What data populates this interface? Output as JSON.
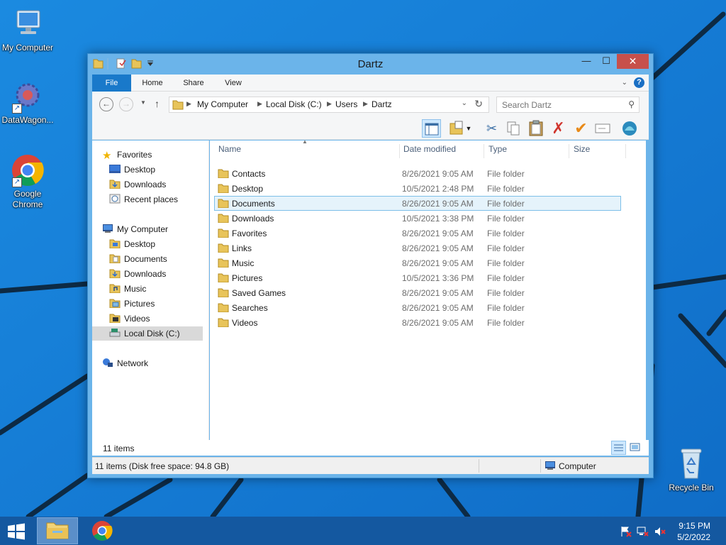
{
  "desktop": {
    "icons": [
      {
        "label": "My Computer"
      },
      {
        "label": "DataWagon..."
      },
      {
        "label": "Google Chrome"
      },
      {
        "label": "Recycle Bin"
      }
    ]
  },
  "window": {
    "title": "Dartz",
    "controls": {
      "minimize": "—",
      "maximize": "☐",
      "close": "✕"
    },
    "ribbon_tabs": {
      "file": "File",
      "home": "Home",
      "share": "Share",
      "view": "View"
    },
    "help": "?",
    "address": {
      "crumbs": [
        "My Computer",
        "Local Disk (C:)",
        "Users",
        "Dartz"
      ]
    },
    "search": {
      "placeholder": "Search Dartz"
    },
    "nav_pane": {
      "favorites": {
        "label": "Favorites",
        "items": [
          "Desktop",
          "Downloads",
          "Recent places"
        ]
      },
      "computer": {
        "label": "My Computer",
        "items": [
          "Desktop",
          "Documents",
          "Downloads",
          "Music",
          "Pictures",
          "Videos",
          "Local Disk (C:)"
        ]
      },
      "network": {
        "label": "Network"
      }
    },
    "columns": {
      "name": "Name",
      "date": "Date modified",
      "type": "Type",
      "size": "Size"
    },
    "files": [
      {
        "name": "Contacts",
        "date": "8/26/2021 9:05 AM",
        "type": "File folder"
      },
      {
        "name": "Desktop",
        "date": "10/5/2021 2:48 PM",
        "type": "File folder"
      },
      {
        "name": "Documents",
        "date": "8/26/2021 9:05 AM",
        "type": "File folder",
        "selected": true
      },
      {
        "name": "Downloads",
        "date": "10/5/2021 3:38 PM",
        "type": "File folder"
      },
      {
        "name": "Favorites",
        "date": "8/26/2021 9:05 AM",
        "type": "File folder"
      },
      {
        "name": "Links",
        "date": "8/26/2021 9:05 AM",
        "type": "File folder"
      },
      {
        "name": "Music",
        "date": "8/26/2021 9:05 AM",
        "type": "File folder"
      },
      {
        "name": "Pictures",
        "date": "10/5/2021 3:36 PM",
        "type": "File folder"
      },
      {
        "name": "Saved Games",
        "date": "8/26/2021 9:05 AM",
        "type": "File folder"
      },
      {
        "name": "Searches",
        "date": "8/26/2021 9:05 AM",
        "type": "File folder"
      },
      {
        "name": "Videos",
        "date": "8/26/2021 9:05 AM",
        "type": "File folder"
      }
    ],
    "item_count": "11 items",
    "status": {
      "text": "11 items (Disk free space: 94.8 GB)",
      "location": "Computer"
    }
  },
  "taskbar": {
    "clock": {
      "time": "9:15 PM",
      "date": "5/2/2022"
    }
  },
  "colors": {
    "accent": "#1979ca",
    "selection": "#e5f3fb",
    "taskbar": "#1458a0",
    "wallpaper": "#1a7fd6"
  }
}
